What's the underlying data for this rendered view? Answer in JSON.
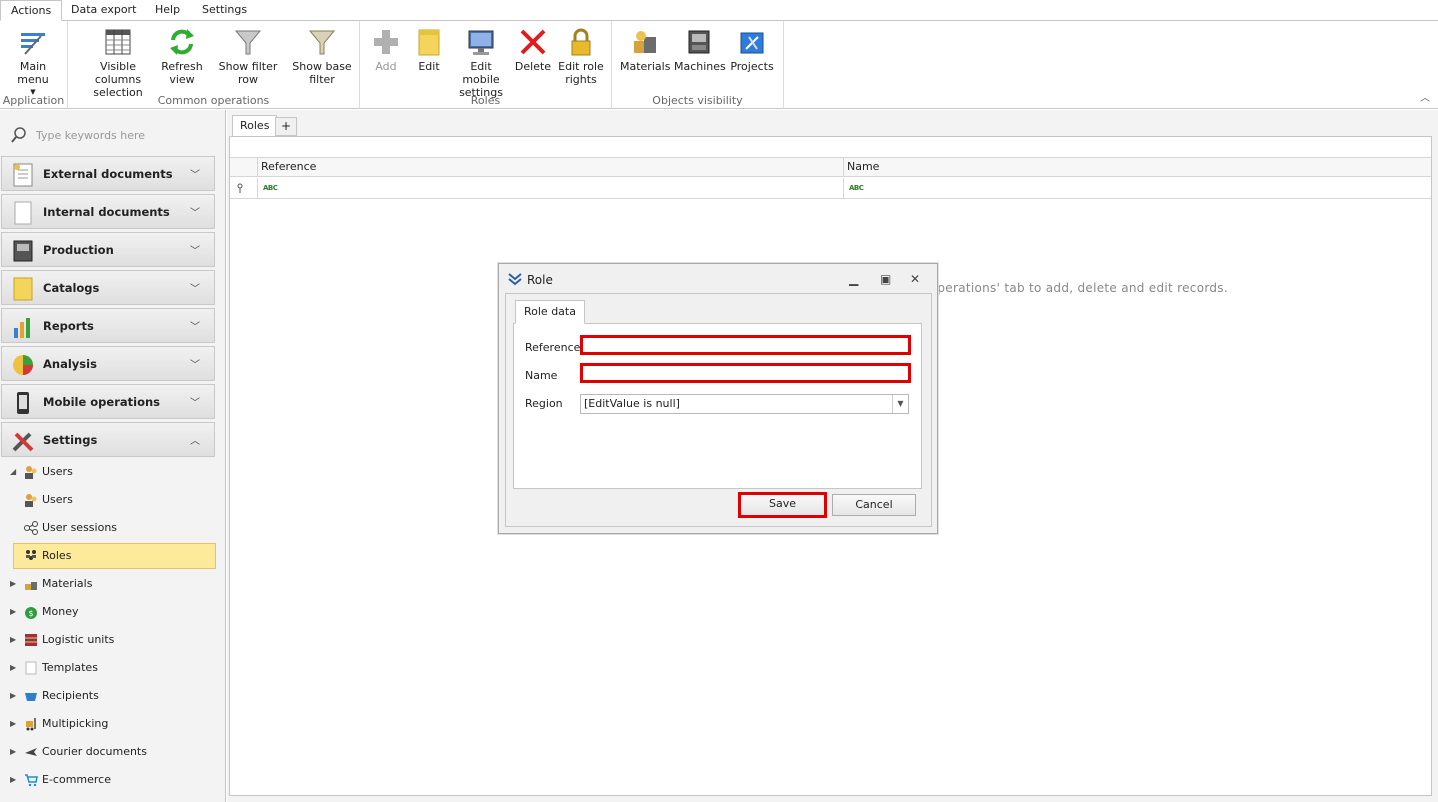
{
  "menu": {
    "tabs": [
      {
        "label": "Actions",
        "active": true
      },
      {
        "label": "Data export"
      },
      {
        "label": "Help"
      },
      {
        "label": "Settings"
      }
    ]
  },
  "ribbon": {
    "groups": {
      "application": {
        "label": "Application"
      },
      "common": {
        "label": "Common operations"
      },
      "roles": {
        "label": "Roles"
      },
      "objects": {
        "label": "Objects visibility"
      }
    },
    "buttons": {
      "main_menu": "Main menu",
      "visible_columns": "Visible columns selection",
      "refresh": "Refresh view",
      "show_filter_row": "Show filter row",
      "show_base_filter": "Show base filter",
      "add": "Add",
      "edit": "Edit",
      "edit_mobile": "Edit mobile settings",
      "delete": "Delete",
      "edit_role_rights": "Edit role rights",
      "materials": "Materials",
      "machines": "Machines",
      "projects": "Projects"
    }
  },
  "sidebar": {
    "search_placeholder": "Type keywords here",
    "groups": [
      "External documents",
      "Internal documents",
      "Production",
      "Catalogs",
      "Reports",
      "Analysis",
      "Mobile operations",
      "Settings"
    ],
    "tree": [
      "Users",
      "Users",
      "User sessions",
      "Roles",
      "Materials",
      "Money",
      "Logistic units",
      "Templates",
      "Recipients",
      "Multipicking",
      "Courier documents",
      "E-commerce"
    ]
  },
  "main": {
    "tab_label": "Roles",
    "add_tab": "+",
    "columns": [
      "Reference",
      "Name"
    ],
    "filter_glyph": "ABC",
    "empty_message": "The table does not contain any records, use the buttons on the 'Operations' tab to add, delete and edit records."
  },
  "dialog": {
    "title": "Role",
    "tab": "Role data",
    "reference_label": "Reference",
    "reference_value": "",
    "name_label": "Name",
    "name_value": "",
    "region_label": "Region",
    "region_value": "[EditValue is null]",
    "save": "Save",
    "cancel": "Cancel"
  },
  "colors": {
    "highlight": "#e00000",
    "selected_bg": "#fdeb9b"
  }
}
